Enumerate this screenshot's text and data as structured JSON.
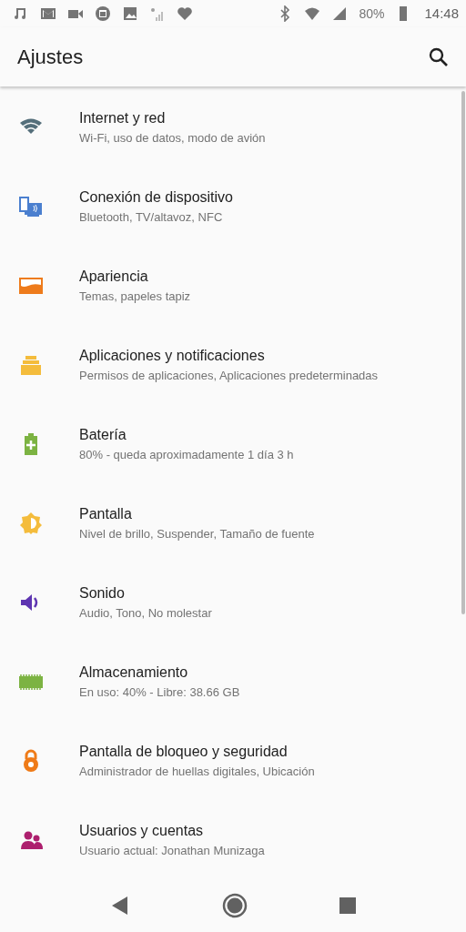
{
  "status_bar": {
    "battery": "80%",
    "time": "14:48"
  },
  "app_bar": {
    "title": "Ajustes"
  },
  "items": [
    {
      "kind": "network",
      "title": "Internet y red",
      "subtitle": "Wi-Fi, uso de datos, modo de avión"
    },
    {
      "kind": "devices",
      "title": "Conexión de dispositivo",
      "subtitle": "Bluetooth, TV/altavoz, NFC"
    },
    {
      "kind": "appearance",
      "title": "Apariencia",
      "subtitle": "Temas, papeles tapiz"
    },
    {
      "kind": "apps",
      "title": "Aplicaciones y notificaciones",
      "subtitle": "Permisos de aplicaciones, Aplicaciones predeterminadas"
    },
    {
      "kind": "battery",
      "title": "Batería",
      "subtitle": "80% - queda aproximadamente 1 día 3 h"
    },
    {
      "kind": "display",
      "title": "Pantalla",
      "subtitle": "Nivel de brillo, Suspender, Tamaño de fuente"
    },
    {
      "kind": "sound",
      "title": "Sonido",
      "subtitle": "Audio, Tono, No molestar"
    },
    {
      "kind": "storage",
      "title": "Almacenamiento",
      "subtitle": "En uso: 40% - Libre: 38.66 GB"
    },
    {
      "kind": "lock",
      "title": "Pantalla de bloqueo y seguridad",
      "subtitle": "Administrador de huellas digitales, Ubicación"
    },
    {
      "kind": "users",
      "title": "Usuarios y cuentas",
      "subtitle": "Usuario actual: Jonathan Munizaga"
    }
  ]
}
